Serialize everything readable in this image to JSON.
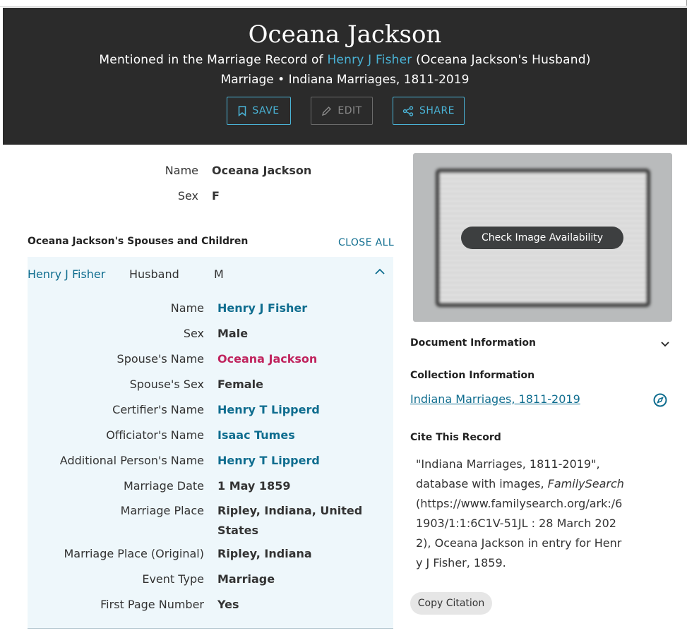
{
  "header": {
    "title": "Oceana Jackson",
    "mentioned_prefix": "Mentioned in the Marriage Record of",
    "mentioned_link": "Henry J Fisher",
    "mentioned_suffix": "(Oceana Jackson's Husband)",
    "record_line": "Marriage • Indiana Marriages, 1811-2019",
    "buttons": {
      "save": "SAVE",
      "edit": "EDIT",
      "share": "SHARE"
    }
  },
  "person": {
    "name_label": "Name",
    "name_value": "Oceana Jackson",
    "sex_label": "Sex",
    "sex_value": "F"
  },
  "spouses": {
    "title": "Oceana Jackson's Spouses and Children",
    "close_all": "CLOSE ALL",
    "spouse_name": "Henry J Fisher",
    "spouse_role": "Husband",
    "spouse_sex": "M",
    "details": [
      {
        "label": "Name",
        "value": "Henry J Fisher",
        "style": "link"
      },
      {
        "label": "Sex",
        "value": "Male",
        "style": "plain"
      },
      {
        "label": "Spouse's Name",
        "value": "Oceana Jackson",
        "style": "pink"
      },
      {
        "label": "Spouse's Sex",
        "value": "Female",
        "style": "plain"
      },
      {
        "label": "Certifier's Name",
        "value": "Henry T Lipperd",
        "style": "link"
      },
      {
        "label": "Officiator's Name",
        "value": "Isaac Tumes",
        "style": "link"
      },
      {
        "label": "Additional Person's Name",
        "value": "Henry T Lipperd",
        "style": "link"
      },
      {
        "label": "Marriage Date",
        "value": "1 May 1859",
        "style": "plain"
      },
      {
        "label": "Marriage Place",
        "value": "Ripley, Indiana, United",
        "value2": "States",
        "style": "plain"
      },
      {
        "label": "Marriage Place (Original)",
        "value": "Ripley, Indiana",
        "style": "plain"
      },
      {
        "label": "Event Type",
        "value": "Marriage",
        "style": "plain"
      },
      {
        "label": "First Page Number",
        "value": "Yes",
        "style": "plain"
      }
    ]
  },
  "sidebar": {
    "check_image": "Check Image Availability",
    "document_info": "Document Information",
    "collection_info": "Collection Information",
    "collection_link": "Indiana Marriages, 1811-2019",
    "cite_title": "Cite This Record",
    "cite_part1": "\"Indiana Marriages, 1811-2019\", database with images,",
    "cite_italic": "FamilySearch",
    "cite_part2": "(https://www.familysearch.org/ark:/61903/1:1:6C1V-51JL : 28 March 2022), Oceana Jackson in entry for Henry J Fisher, 1859.",
    "copy_citation": "Copy Citation"
  },
  "colors": {
    "header_bg": "#2b2b2b",
    "link": "#0f6d8f",
    "header_link": "#4ab3d6",
    "highlight": "#c0245e",
    "panel_bg": "#eef7fb"
  }
}
